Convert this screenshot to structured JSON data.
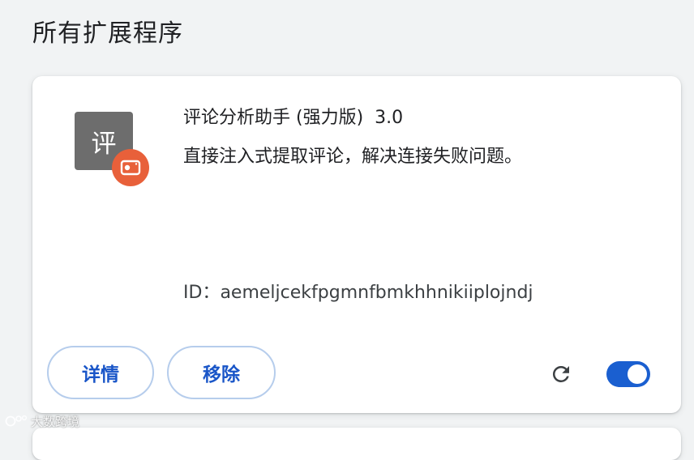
{
  "section": {
    "title": "所有扩展程序"
  },
  "extension": {
    "icon_char": "评",
    "icon_color": "#6d6d6d",
    "badge_color": "#e8603a",
    "badge_icon": "warning-camera-icon",
    "name": "评论分析助手 (强力版)",
    "version": "3.0",
    "description": "直接注入式提取评论，解决连接失败问题。",
    "id_label": "ID：",
    "id_value": "aemeljcekfpgmnfbmkhhnikiiplojndj",
    "details_label": "详情",
    "remove_label": "移除",
    "reload_icon": "reload-icon",
    "enabled": true,
    "accent_color": "#1a5fd0"
  },
  "watermark": {
    "text": "大数跨境"
  }
}
